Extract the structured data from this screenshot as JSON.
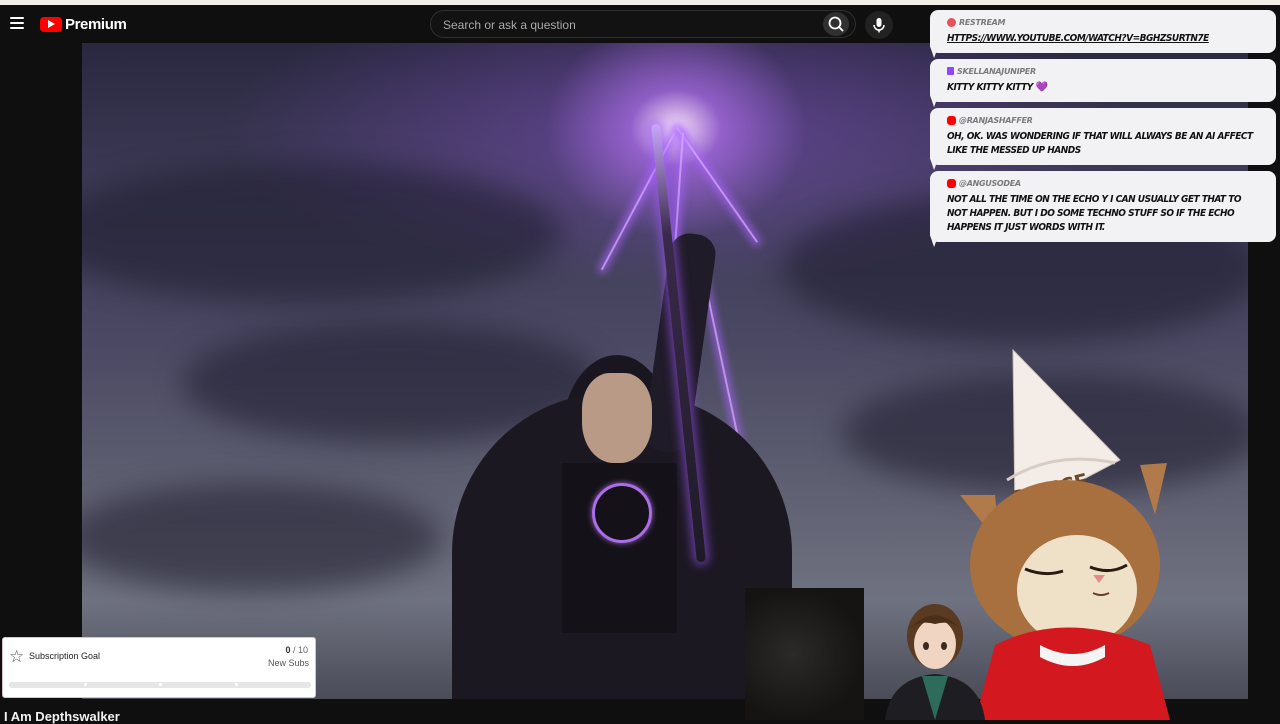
{
  "header": {
    "brand": "Premium",
    "search_placeholder": "Search or ask a question"
  },
  "chat": [
    {
      "platform": "restream",
      "user": "RESTREAM",
      "message": "HTTPS://WWW.YOUTUBE.COM/WATCH?V=BGHZSURTN7E",
      "is_link": true
    },
    {
      "platform": "twitch",
      "user": "SKELLANAJUNIPER",
      "message": "KITTY KITTY KITTY",
      "emoji": "💜"
    },
    {
      "platform": "youtube",
      "user": "@RANJASHAFFER",
      "message": "OH, OK. WAS WONDERING IF THAT WILL ALWAYS BE AN AI AFFECT LIKE THE MESSED UP HANDS"
    },
    {
      "platform": "youtube",
      "user": "@ANGUSODEA",
      "message": "NOT ALL THE TIME ON THE ECHO Y I CAN USUALLY GET THAT TO NOT HAPPEN. BUT I DO SOME TECHNO STUFF SO IF THE ECHO HAPPENS IT JUST WORDS WITH IT."
    }
  ],
  "colors": {
    "restream": "#e8505b",
    "twitch": "#9146ff",
    "youtube": "#ff0000",
    "goal_fill": "#d94a6a"
  },
  "goal": {
    "title": "Subscription Goal",
    "current": "0",
    "total": "/ 10",
    "subtitle": "New Subs",
    "progress": 0
  },
  "overlay": {
    "hat_text": "DUNCE"
  },
  "video": {
    "title": "I Am Depthswalker"
  }
}
